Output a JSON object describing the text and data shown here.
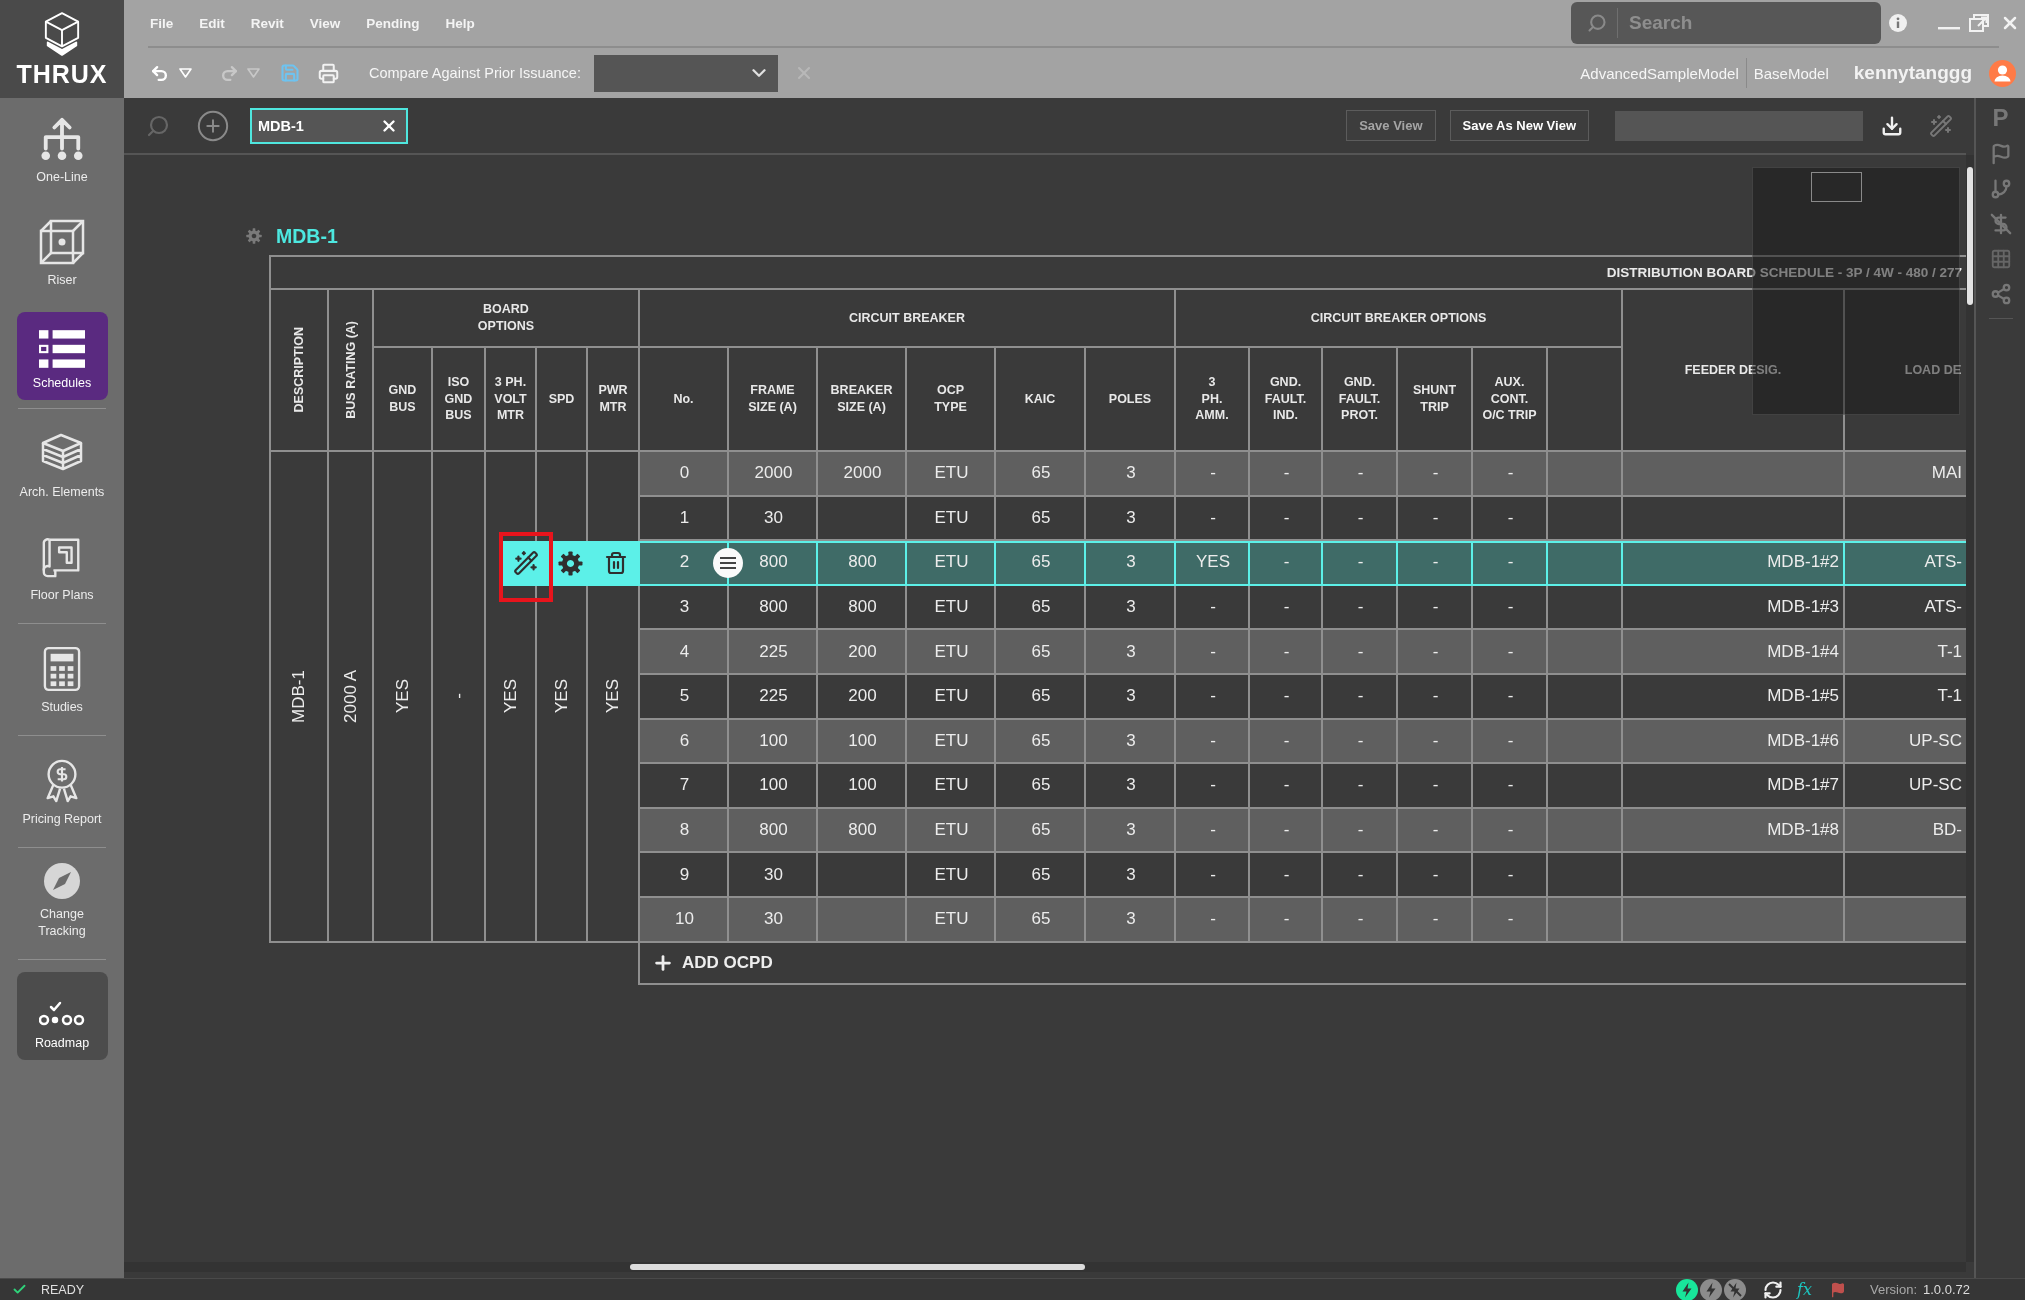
{
  "app": {
    "logo": "THRUX"
  },
  "sidebar": {
    "groups": [
      {
        "items": [
          {
            "label": "One-Line",
            "selected": false,
            "hovered": false
          },
          {
            "label": "Riser",
            "selected": false,
            "hovered": false
          },
          {
            "label": "Schedules",
            "selected": true,
            "hovered": false
          }
        ]
      },
      {
        "items": [
          {
            "label": "Arch. Elements",
            "selected": false,
            "hovered": false
          },
          {
            "label": "Floor Plans",
            "selected": false,
            "hovered": false
          }
        ]
      },
      {
        "items": [
          {
            "label": "Studies",
            "selected": false,
            "hovered": false
          }
        ]
      },
      {
        "items": [
          {
            "label": "Pricing Report",
            "selected": false,
            "hovered": false
          }
        ]
      },
      {
        "items": [
          {
            "label": "Change Tracking",
            "selected": false,
            "hovered": false
          }
        ]
      },
      {
        "items": [
          {
            "label": "Roadmap",
            "selected": false,
            "hovered": true
          }
        ]
      }
    ]
  },
  "menu": [
    "File",
    "Edit",
    "Revit",
    "View",
    "Pending",
    "Help"
  ],
  "search": {
    "placeholder": "Search"
  },
  "toolbar": {
    "undo": {
      "disabled": false
    },
    "redo": {
      "disabled": true
    },
    "compare_label": "Compare Against Prior Issuance:",
    "compare_clear": {
      "disabled": true
    }
  },
  "models": [
    "AdvancedSampleModel",
    "BaseModel"
  ],
  "user": {
    "name": "kennytanggg"
  },
  "view_bar": {
    "tabs": [
      {
        "label": "MDB-1",
        "selected": true
      }
    ],
    "buttons": [
      {
        "label": "Save View",
        "disabled": true
      },
      {
        "label": "Save As New View",
        "disabled": false
      }
    ]
  },
  "rail": {
    "label": "P"
  },
  "schedule": {
    "title": "MDB-1",
    "banner": "DISTRIBUTION BOARD SCHEDULE - 3P / 4W - 480 / 277",
    "header": [
      {
        "label": "DESCRIPTION",
        "kind": "vertical"
      },
      {
        "label": "BUS RATING (A)",
        "kind": "vertical"
      },
      {
        "label": "BOARD\nOPTIONS",
        "kind": "group",
        "columns": [
          {
            "label": "GND\nBUS",
            "kind": "label"
          },
          {
            "label": "ISO\nGND\nBUS",
            "kind": "label"
          },
          {
            "label": "3 PH.\nVOLT\nMTR",
            "kind": "label"
          },
          {
            "label": "SPD",
            "kind": "label"
          },
          {
            "label": "PWR\nMTR",
            "kind": "label"
          }
        ]
      },
      {
        "label": "CIRCUIT BREAKER",
        "kind": "group",
        "columns": [
          {
            "label": "No.",
            "kind": "label"
          },
          {
            "label": "FRAME\nSIZE (A)",
            "kind": "label"
          },
          {
            "label": "BREAKER\nSIZE (A)",
            "kind": "label"
          },
          {
            "label": "OCP\nTYPE",
            "kind": "label"
          },
          {
            "label": "KAIC",
            "kind": "label"
          },
          {
            "label": "POLES",
            "kind": "label"
          }
        ]
      },
      {
        "label": "CIRCUIT BREAKER OPTIONS",
        "kind": "group",
        "columns": [
          {
            "label": "3\nPH.\nAMM.",
            "kind": "label"
          },
          {
            "label": "GND.\nFAULT.\nIND.",
            "kind": "label"
          },
          {
            "label": "GND.\nFAULT.\nPROT.",
            "kind": "label"
          },
          {
            "label": "SHUNT\nTRIP",
            "kind": "label"
          },
          {
            "label": "AUX.\nCONT.\nO/C TRIP",
            "kind": "label"
          },
          {
            "kind": "blank"
          }
        ]
      },
      {
        "label": "FEEDER DESIG.",
        "kind": "plain"
      },
      {
        "label": "LOAD DE",
        "kind": "plain"
      }
    ],
    "board": [
      "MDB-1",
      "2000 A",
      "YES",
      "-",
      "YES",
      "YES",
      "YES"
    ],
    "rows": [
      {
        "no": "0",
        "frame": "2000",
        "breaker": "2000",
        "ocp": "ETU",
        "kaic": "65",
        "poles": "3",
        "amm": "-",
        "gf_ind": "-",
        "gf_prot": "-",
        "shunt": "-",
        "aux": "-",
        "load": "MAI",
        "selected": false
      },
      {
        "no": "1",
        "frame": "30",
        "ocp": "ETU",
        "kaic": "65",
        "poles": "3",
        "amm": "-",
        "gf_ind": "-",
        "gf_prot": "-",
        "shunt": "-",
        "aux": "-",
        "selected": false
      },
      {
        "no": "2",
        "frame": "800",
        "breaker": "800",
        "ocp": "ETU",
        "kaic": "65",
        "poles": "3",
        "amm": "YES",
        "gf_ind": "-",
        "gf_prot": "-",
        "shunt": "-",
        "aux": "-",
        "feeder": "MDB-1#2",
        "load": "ATS-",
        "selected": true
      },
      {
        "no": "3",
        "frame": "800",
        "breaker": "800",
        "ocp": "ETU",
        "kaic": "65",
        "poles": "3",
        "amm": "-",
        "gf_ind": "-",
        "gf_prot": "-",
        "shunt": "-",
        "aux": "-",
        "feeder": "MDB-1#3",
        "load": "ATS-",
        "selected": false
      },
      {
        "no": "4",
        "frame": "225",
        "breaker": "200",
        "ocp": "ETU",
        "kaic": "65",
        "poles": "3",
        "amm": "-",
        "gf_ind": "-",
        "gf_prot": "-",
        "shunt": "-",
        "aux": "-",
        "feeder": "MDB-1#4",
        "load": "T-1",
        "selected": false
      },
      {
        "no": "5",
        "frame": "225",
        "breaker": "200",
        "ocp": "ETU",
        "kaic": "65",
        "poles": "3",
        "amm": "-",
        "gf_ind": "-",
        "gf_prot": "-",
        "shunt": "-",
        "aux": "-",
        "feeder": "MDB-1#5",
        "load": "T-1",
        "selected": false
      },
      {
        "no": "6",
        "frame": "100",
        "breaker": "100",
        "ocp": "ETU",
        "kaic": "65",
        "poles": "3",
        "amm": "-",
        "gf_ind": "-",
        "gf_prot": "-",
        "shunt": "-",
        "aux": "-",
        "feeder": "MDB-1#6",
        "load": "UP-SC",
        "selected": false
      },
      {
        "no": "7",
        "frame": "100",
        "breaker": "100",
        "ocp": "ETU",
        "kaic": "65",
        "poles": "3",
        "amm": "-",
        "gf_ind": "-",
        "gf_prot": "-",
        "shunt": "-",
        "aux": "-",
        "feeder": "MDB-1#7",
        "load": "UP-SC",
        "selected": false
      },
      {
        "no": "8",
        "frame": "800",
        "breaker": "800",
        "ocp": "ETU",
        "kaic": "65",
        "poles": "3",
        "amm": "-",
        "gf_ind": "-",
        "gf_prot": "-",
        "shunt": "-",
        "aux": "-",
        "feeder": "MDB-1#8",
        "load": "BD-",
        "selected": false
      },
      {
        "no": "9",
        "frame": "30",
        "ocp": "ETU",
        "kaic": "65",
        "poles": "3",
        "amm": "-",
        "gf_ind": "-",
        "gf_prot": "-",
        "shunt": "-",
        "aux": "-",
        "selected": false
      },
      {
        "no": "10",
        "frame": "30",
        "ocp": "ETU",
        "kaic": "65",
        "poles": "3",
        "amm": "-",
        "gf_ind": "-",
        "gf_prot": "-",
        "shunt": "-",
        "aux": "-",
        "selected": false
      }
    ],
    "add_label": "ADD OCPD"
  },
  "status_bar": {
    "state": "READY",
    "formula": "fx",
    "version_label": "Version:",
    "version": "1.0.0.72"
  }
}
